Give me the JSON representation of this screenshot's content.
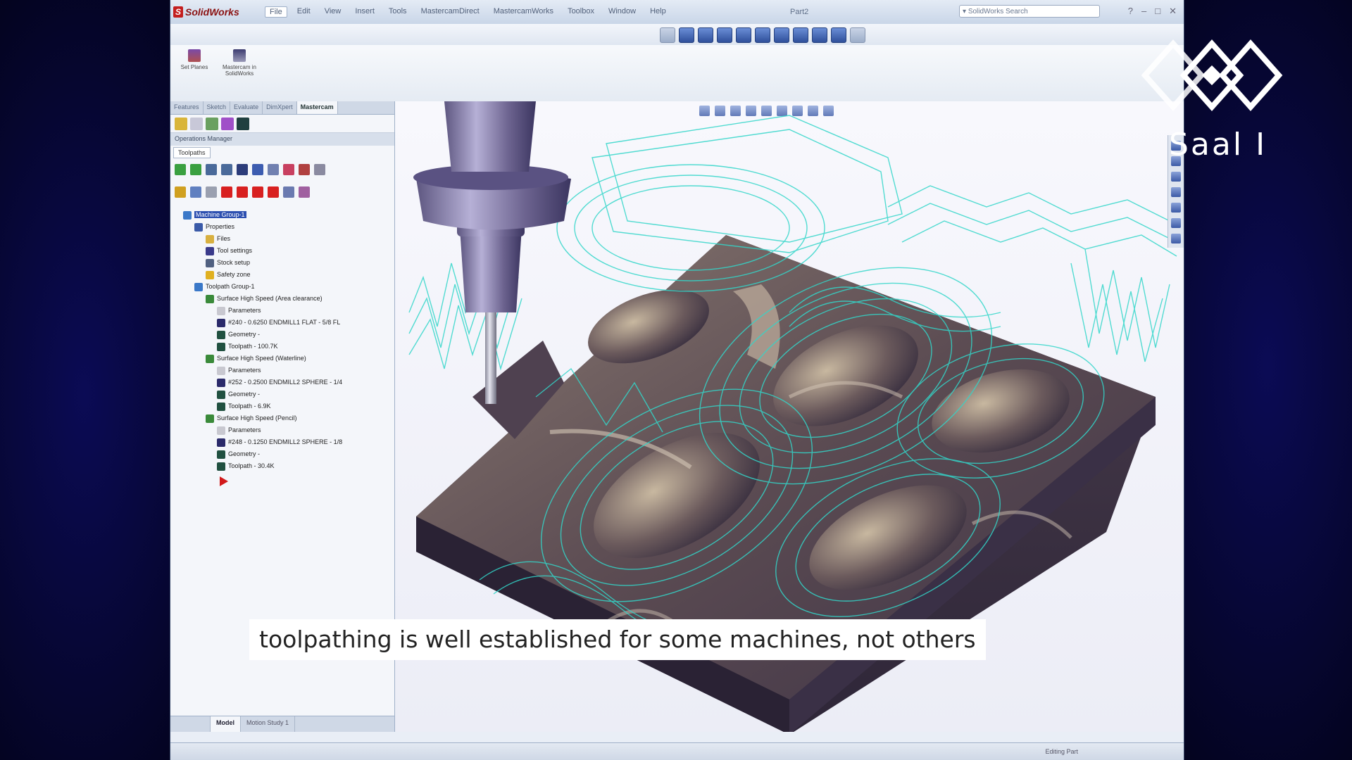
{
  "window": {
    "app_name": "SolidWorks",
    "document_title": "Part2",
    "search_placeholder": "SolidWorks Search",
    "menu": [
      "File",
      "Edit",
      "View",
      "Insert",
      "Tools",
      "MastercamDirect",
      "MastercamWorks",
      "Toolbox",
      "Window",
      "Help"
    ],
    "active_menu": "File"
  },
  "command_manager": {
    "buttons": [
      {
        "label": "Set Planes",
        "icon": "planes-icon"
      },
      {
        "label": "Mastercam in SolidWorks",
        "icon": "mastercam-icon"
      }
    ]
  },
  "left_panel": {
    "tabs": [
      "Features",
      "Sketch",
      "Evaluate",
      "DimXpert",
      "Mastercam"
    ],
    "active_tab": "Mastercam",
    "header": "Operations Manager",
    "subtab": "Toolpaths",
    "tree": [
      {
        "label": "Machine Group-1",
        "level": 0,
        "icon": "machine-group-icon",
        "selected": true
      },
      {
        "label": "Properties",
        "level": 1,
        "icon": "properties-icon"
      },
      {
        "label": "Files",
        "level": 2,
        "icon": "files-icon"
      },
      {
        "label": "Tool settings",
        "level": 2,
        "icon": "tool-settings-icon"
      },
      {
        "label": "Stock setup",
        "level": 2,
        "icon": "stock-setup-icon"
      },
      {
        "label": "Safety zone",
        "level": 2,
        "icon": "safety-zone-icon"
      },
      {
        "label": "Toolpath Group-1",
        "level": 1,
        "icon": "toolpath-group-icon"
      },
      {
        "label": "Surface High Speed (Area clearance)",
        "level": 2,
        "icon": "operation-icon"
      },
      {
        "label": "Parameters",
        "level": 3,
        "icon": "parameters-icon"
      },
      {
        "label": "#240 - 0.6250 ENDMILL1 FLAT - 5/8 FL",
        "level": 3,
        "icon": "tool-icon"
      },
      {
        "label": "Geometry -",
        "level": 3,
        "icon": "geometry-icon"
      },
      {
        "label": "Toolpath - 100.7K",
        "level": 3,
        "icon": "toolpath-icon"
      },
      {
        "label": "Surface High Speed (Waterline)",
        "level": 2,
        "icon": "operation-icon"
      },
      {
        "label": "Parameters",
        "level": 3,
        "icon": "parameters-icon"
      },
      {
        "label": "#252 - 0.2500 ENDMILL2 SPHERE - 1/4",
        "level": 3,
        "icon": "tool-icon"
      },
      {
        "label": "Geometry -",
        "level": 3,
        "icon": "geometry-icon"
      },
      {
        "label": "Toolpath - 6.9K",
        "level": 3,
        "icon": "toolpath-icon"
      },
      {
        "label": "Surface High Speed (Pencil)",
        "level": 2,
        "icon": "operation-icon"
      },
      {
        "label": "Parameters",
        "level": 3,
        "icon": "parameters-icon"
      },
      {
        "label": "#248 - 0.1250 ENDMILL2 SPHERE - 1/8",
        "level": 3,
        "icon": "tool-icon"
      },
      {
        "label": "Geometry -",
        "level": 3,
        "icon": "geometry-icon"
      },
      {
        "label": "Toolpath - 30.4K",
        "level": 3,
        "icon": "toolpath-icon"
      }
    ],
    "bottom_tabs": [
      "",
      "Model",
      "Motion Study 1"
    ],
    "active_bottom_tab": "Model"
  },
  "status_bar": {
    "text": "Editing Part"
  },
  "overlay": {
    "subtitle": "toolpathing is well established for some machines, not others",
    "room_label": "Saal I"
  },
  "colors": {
    "toolpath": "#33d6c9",
    "part": "#5c4d58",
    "selection": "#2c4fb0",
    "end_marker": "#d21a1a"
  }
}
